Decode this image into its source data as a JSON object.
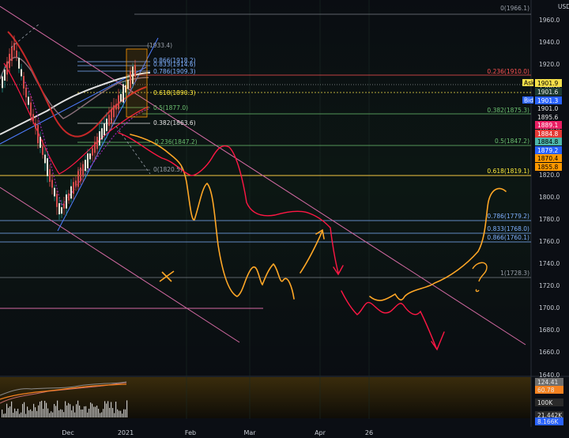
{
  "axis": {
    "currency": "USD",
    "price_ticks": [
      "1960.0",
      "1940.0",
      "1920.0",
      "1900.0",
      "1880.0",
      "1860.0",
      "1840.0",
      "1820.0",
      "1800.0",
      "1780.0",
      "1760.0",
      "1740.0",
      "1720.0",
      "1700.0",
      "1680.0",
      "1660.0",
      "1640.0"
    ],
    "time_ticks": [
      "Dec",
      "2021",
      "Feb",
      "Mar",
      "Apr",
      "26"
    ]
  },
  "fib_left": [
    {
      "text": "(1933.4)",
      "color": "#9aa0aa"
    },
    {
      "text": "0.866(1918.2)",
      "color": "#7fb0ff"
    },
    {
      "text": "0.833(1914.6)",
      "color": "#7fb0ff"
    },
    {
      "text": "0.786(1909.3)",
      "color": "#7fb0ff"
    },
    {
      "text": "0.618(1890.3)",
      "color": "#ffeb3b"
    },
    {
      "text": "0.5(1877.0)",
      "color": "#6cc070"
    },
    {
      "text": "0.382(1863.6)",
      "color": "#e6e6e6"
    },
    {
      "text": "0.236(1847.2)",
      "color": "#6cc070"
    },
    {
      "text": "0(1820.5)",
      "color": "#9aa0aa"
    }
  ],
  "fib_right": [
    {
      "text": "0(1966.1)",
      "color": "#9aa0aa"
    },
    {
      "text": "0.236(1910.0)",
      "color": "#ff5252"
    },
    {
      "text": "0.382(1875.3)",
      "color": "#6cc070"
    },
    {
      "text": "0.5(1847.2)",
      "color": "#6cc070"
    },
    {
      "text": "0.618(1819.1)",
      "color": "#ffeb3b"
    },
    {
      "text": "0.786(1779.2)",
      "color": "#7fb0ff"
    },
    {
      "text": "0.833(1768.0)",
      "color": "#7fb0ff"
    },
    {
      "text": "0.866(1760.1)",
      "color": "#7fb0ff"
    },
    {
      "text": "1(1728.3)",
      "color": "#9aa0aa"
    }
  ],
  "price_tags": [
    {
      "text": "1901.9",
      "bg": "#f5e04a",
      "fg": "#000000",
      "prefix": "Ask"
    },
    {
      "text": "1901.6",
      "bg": "#1e3b32",
      "fg": "#e6e6e6",
      "prefix": ""
    },
    {
      "text": "1901.3",
      "bg": "#2962ff",
      "fg": "#ffffff",
      "prefix": "Bid"
    },
    {
      "text": "1901.0",
      "bg": "#0b0e14",
      "fg": "#e6e6e6",
      "prefix": ""
    },
    {
      "text": "1895.6",
      "bg": "#0b0e14",
      "fg": "#e6e6e6",
      "prefix": ""
    },
    {
      "text": "1889.1",
      "bg": "#e91e63",
      "fg": "#ffffff",
      "prefix": ""
    },
    {
      "text": "1884.8",
      "bg": "#e53935",
      "fg": "#ffffff",
      "prefix": ""
    },
    {
      "text": "1884.8",
      "bg": "#4db6ac",
      "fg": "#000000",
      "prefix": ""
    },
    {
      "text": "1879.2",
      "bg": "#2962ff",
      "fg": "#ffffff",
      "prefix": ""
    },
    {
      "text": "1870.4",
      "bg": "#ff9800",
      "fg": "#000000",
      "prefix": ""
    },
    {
      "text": "1855.8",
      "bg": "#ff9800",
      "fg": "#000000",
      "prefix": ""
    }
  ],
  "indicator": {
    "ticks": [
      "124.41",
      "60.78",
      "100K",
      "21.442K",
      "8.166K"
    ],
    "tag_colors": [
      "#6d6d6d",
      "#f58220",
      "#2a2a2a",
      "#2a2a2a",
      "#2962ff"
    ]
  }
}
